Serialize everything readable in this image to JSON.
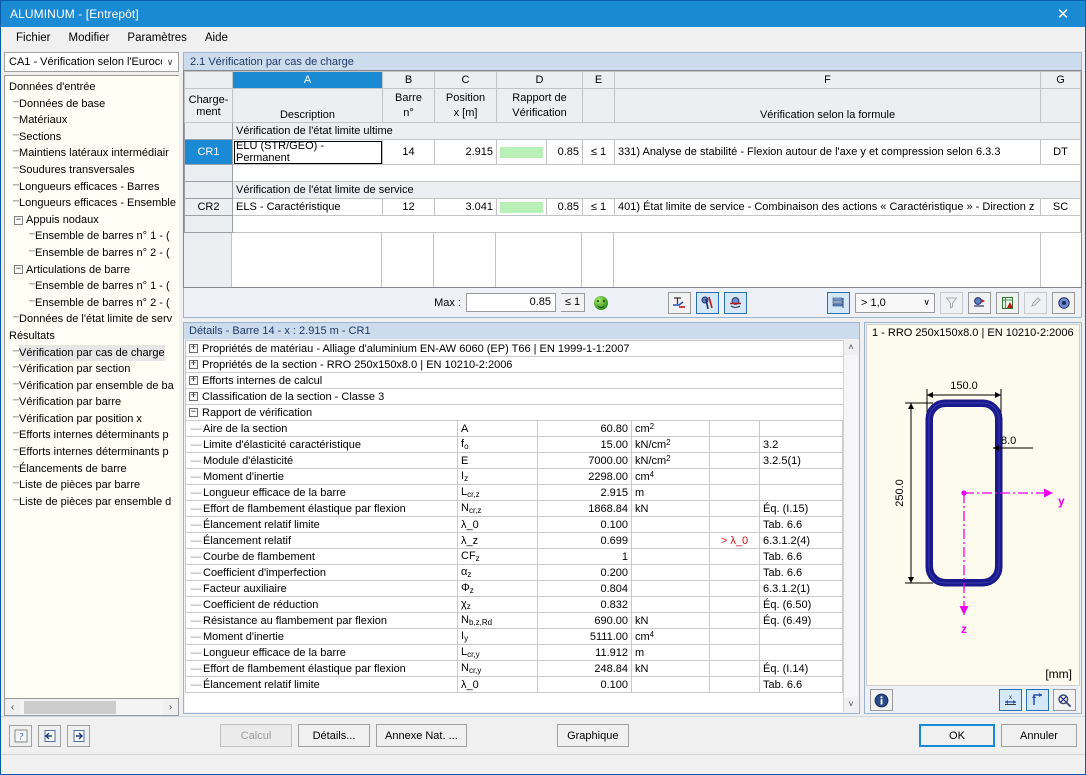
{
  "window": {
    "title": "ALUMINUM - [Entrepôt]",
    "close_icon": "close-icon"
  },
  "menu": {
    "items": [
      "Fichier",
      "Modifier",
      "Paramètres",
      "Aide"
    ]
  },
  "sidebar": {
    "combo_value": "CA1 - Vérification selon l'Euroco",
    "tree": [
      {
        "label": "Données d'entrée",
        "level": 0,
        "expander": "",
        "selected": false
      },
      {
        "label": "Données de base",
        "level": 1,
        "expander": "",
        "selected": false
      },
      {
        "label": "Matériaux",
        "level": 1,
        "expander": "",
        "selected": false
      },
      {
        "label": "Sections",
        "level": 1,
        "expander": "",
        "selected": false
      },
      {
        "label": "Maintiens latéraux intermédiair",
        "level": 1,
        "expander": "",
        "selected": false
      },
      {
        "label": "Soudures transversales",
        "level": 1,
        "expander": "",
        "selected": false
      },
      {
        "label": "Longueurs efficaces - Barres",
        "level": 1,
        "expander": "",
        "selected": false
      },
      {
        "label": "Longueurs efficaces - Ensemble",
        "level": 1,
        "expander": "",
        "selected": false
      },
      {
        "label": "Appuis nodaux",
        "level": 1,
        "expander": "−",
        "selected": false
      },
      {
        "label": "Ensemble de barres n° 1 - (",
        "level": 2,
        "expander": "",
        "selected": false
      },
      {
        "label": "Ensemble de barres n° 2 - (",
        "level": 2,
        "expander": "",
        "selected": false
      },
      {
        "label": "Articulations de barre",
        "level": 1,
        "expander": "−",
        "selected": false
      },
      {
        "label": "Ensemble de barres n° 1 - (",
        "level": 2,
        "expander": "",
        "selected": false
      },
      {
        "label": "Ensemble de barres n° 2 - (",
        "level": 2,
        "expander": "",
        "selected": false
      },
      {
        "label": "Données de l'état limite de serv",
        "level": 1,
        "expander": "",
        "selected": false
      },
      {
        "label": "Résultats",
        "level": 0,
        "expander": "",
        "selected": false
      },
      {
        "label": "Vérification par cas de charge",
        "level": 1,
        "expander": "",
        "selected": true
      },
      {
        "label": "Vérification par section",
        "level": 1,
        "expander": "",
        "selected": false
      },
      {
        "label": "Vérification par ensemble de ba",
        "level": 1,
        "expander": "",
        "selected": false
      },
      {
        "label": "Vérification par barre",
        "level": 1,
        "expander": "",
        "selected": false
      },
      {
        "label": "Vérification par position x",
        "level": 1,
        "expander": "",
        "selected": false
      },
      {
        "label": "Efforts internes déterminants p",
        "level": 1,
        "expander": "",
        "selected": false
      },
      {
        "label": "Efforts internes déterminants p",
        "level": 1,
        "expander": "",
        "selected": false
      },
      {
        "label": "Élancements de barre",
        "level": 1,
        "expander": "",
        "selected": false
      },
      {
        "label": "Liste de pièces par barre",
        "level": 1,
        "expander": "",
        "selected": false
      },
      {
        "label": "Liste de pièces  par ensemble d",
        "level": 1,
        "expander": "",
        "selected": false
      }
    ],
    "scroll_left_icon": "chevron-left-icon",
    "scroll_right_icon": "chevron-right-icon"
  },
  "main": {
    "section_title": "2.1 Vérification par cas de charge",
    "grid": {
      "column_letters": [
        "A",
        "B",
        "C",
        "D",
        "E",
        "F",
        "G"
      ],
      "corner_header": "Charge-\nment",
      "corner_header_line1": "Charge-",
      "corner_header_line2": "ment",
      "sub_headers": {
        "a": "Description",
        "b_line1": "Barre",
        "b_line2": "n°",
        "c_line1": "Position",
        "c_line2": "x [m]",
        "d_line1": "Rapport de",
        "d_line2": "Vérification",
        "e": "",
        "f": "Vérification selon la formule",
        "g": ""
      },
      "group_ultimate": "Vérification de l'état limite ultime",
      "group_service": "Vérification de l'état limite de service",
      "rows": [
        {
          "id": "CR1",
          "description": "ELU (STR/GEO) - Permanent",
          "barre": "14",
          "position": "2.915",
          "ratio": "0.85",
          "limit": "≤ 1",
          "formula": "331) Analyse de stabilité - Flexion autour de l'axe y et compression selon 6.3.3",
          "sc": "DT"
        },
        {
          "id": "CR2",
          "description": "ELS - Caractéristique",
          "barre": "12",
          "position": "3.041",
          "ratio": "0.85",
          "limit": "≤ 1",
          "formula": "401) État limite de service - Combinaison des actions « Caractéristique » - Direction z",
          "sc": "SC"
        }
      ]
    },
    "maxbar": {
      "label": "Max :",
      "value": "0.85",
      "limit": "≤ 1",
      "status_icon": "green-smiley-icon",
      "filter_value": "> 1,0",
      "buttons": [
        {
          "name": "section-view-button",
          "icon": "section-view-icon",
          "active": false
        },
        {
          "name": "member-view-button",
          "icon": "member-view-icon",
          "active": true
        },
        {
          "name": "support-view-button",
          "icon": "support-view-icon",
          "active": true
        },
        {
          "name": "color-bars-button",
          "icon": "color-bars-icon",
          "active": true
        },
        {
          "name": "filter-button",
          "icon": "funnel-icon",
          "active": false
        },
        {
          "name": "render-button",
          "icon": "render-icon",
          "active": false
        },
        {
          "name": "excel-export-button",
          "icon": "excel-icon",
          "active": false
        },
        {
          "name": "pen-button",
          "icon": "pen-icon",
          "active": false
        },
        {
          "name": "view-button",
          "icon": "eye-icon",
          "active": false
        }
      ]
    }
  },
  "details": {
    "header": "Détails - Barre 14 - x : 2.915 m - CR1",
    "groups": [
      {
        "expander": "+",
        "label": "Propriétés de matériau - Alliage d'aluminium EN-AW 6060 (EP) T66 | EN 1999-1-1:2007"
      },
      {
        "expander": "+",
        "label": "Propriétés de la section  -  RRO 250x150x8.0 | EN 10210-2:2006"
      },
      {
        "expander": "+",
        "label": "Efforts internes de calcul"
      },
      {
        "expander": "+",
        "label": "Classification de la section - Classe 3"
      },
      {
        "expander": "−",
        "label": "Rapport de vérification"
      }
    ],
    "columns": [
      "label",
      "symbol",
      "value",
      "unit",
      "note",
      "reference"
    ],
    "rows": [
      {
        "label": "Aire de la section",
        "symbol": "A",
        "sym_sub": "",
        "value": "60.80",
        "unit": "cm",
        "unit_sup": "2",
        "note": "",
        "ref": ""
      },
      {
        "label": "Limite d'élasticité caractéristique",
        "symbol": "f",
        "sym_sub": "o",
        "value": "15.00",
        "unit": "kN/cm",
        "unit_sup": "2",
        "note": "",
        "ref": "3.2"
      },
      {
        "label": "Module d'élasticité",
        "symbol": "E",
        "sym_sub": "",
        "value": "7000.00",
        "unit": "kN/cm",
        "unit_sup": "2",
        "note": "",
        "ref": "3.2.5(1)"
      },
      {
        "label": "Moment d'inertie",
        "symbol": "I",
        "sym_sub": "z",
        "value": "2298.00",
        "unit": "cm",
        "unit_sup": "4",
        "note": "",
        "ref": ""
      },
      {
        "label": "Longueur efficace de la barre",
        "symbol": "L",
        "sym_sub": "cr,z",
        "value": "2.915",
        "unit": "m",
        "unit_sup": "",
        "note": "",
        "ref": ""
      },
      {
        "label": "Effort de flambement élastique par flexion",
        "symbol": "N",
        "sym_sub": "cr,z",
        "value": "1868.84",
        "unit": "kN",
        "unit_sup": "",
        "note": "",
        "ref": "Éq. (I.15)"
      },
      {
        "label": "Élancement relatif limite",
        "symbol": "λ_0",
        "sym_sub": "",
        "value": "0.100",
        "unit": "",
        "unit_sup": "",
        "note": "",
        "ref": "Tab. 6.6"
      },
      {
        "label": "Élancement relatif",
        "symbol": "λ_z",
        "sym_sub": "",
        "value": "0.699",
        "unit": "",
        "unit_sup": "",
        "note": "> λ_0",
        "ref": "6.3.1.2(4)"
      },
      {
        "label": "Courbe de flambement",
        "symbol": "CF",
        "sym_sub": "z",
        "value": "1",
        "unit": "",
        "unit_sup": "",
        "note": "",
        "ref": "Tab. 6.6"
      },
      {
        "label": "Coefficient d'imperfection",
        "symbol": "α",
        "sym_sub": "z",
        "value": "0.200",
        "unit": "",
        "unit_sup": "",
        "note": "",
        "ref": "Tab. 6.6"
      },
      {
        "label": "Facteur auxiliaire",
        "symbol": "Φ",
        "sym_sub": "z",
        "value": "0.804",
        "unit": "",
        "unit_sup": "",
        "note": "",
        "ref": "6.3.1.2(1)"
      },
      {
        "label": "Coefficient de réduction",
        "symbol": "χ",
        "sym_sub": "z",
        "value": "0.832",
        "unit": "",
        "unit_sup": "",
        "note": "",
        "ref": "Éq. (6.50)"
      },
      {
        "label": "Résistance au flambement par flexion",
        "symbol": "N",
        "sym_sub": "b,z,Rd",
        "value": "690.00",
        "unit": "kN",
        "unit_sup": "",
        "note": "",
        "ref": "Éq. (6.49)"
      },
      {
        "label": "Moment d'inertie",
        "symbol": "I",
        "sym_sub": "y",
        "value": "5111.00",
        "unit": "cm",
        "unit_sup": "4",
        "note": "",
        "ref": ""
      },
      {
        "label": "Longueur efficace de la barre",
        "symbol": "L",
        "sym_sub": "cr,y",
        "value": "11.912",
        "unit": "m",
        "unit_sup": "",
        "note": "",
        "ref": ""
      },
      {
        "label": "Effort de flambement élastique par flexion",
        "symbol": "N",
        "sym_sub": "cr,y",
        "value": "248.84",
        "unit": "kN",
        "unit_sup": "",
        "note": "",
        "ref": "Éq. (I.14)"
      },
      {
        "label": "Élancement relatif limite",
        "symbol": "λ_0",
        "sym_sub": "",
        "value": "0.100",
        "unit": "",
        "unit_sup": "",
        "note": "",
        "ref": "Tab. 6.6"
      }
    ],
    "scroll_up_icon": "chevron-up-icon",
    "scroll_down_icon": "chevron-down-icon"
  },
  "section_view": {
    "title": "1 - RRO 250x150x8.0 | EN 10210-2:2006",
    "dim_width": "150.0",
    "dim_height": "250.0",
    "dim_thickness": "8.0",
    "axis_y": "y",
    "axis_z": "z",
    "units": "[mm]",
    "outline_color": "#1a1a8c",
    "axis_color": "#ee00ee",
    "buttons": [
      {
        "name": "info-button",
        "icon": "info-icon",
        "active": false
      },
      {
        "name": "dimensions-button",
        "icon": "dimension-icon",
        "active": true
      },
      {
        "name": "axes-button",
        "icon": "axes-icon",
        "active": true
      },
      {
        "name": "zoom-reset-button",
        "icon": "zoom-reset-icon",
        "active": false
      }
    ]
  },
  "bottom": {
    "help_icon": "help-icon",
    "prev_icon": "prev-view-icon",
    "next_icon": "next-view-icon",
    "calcul": "Calcul",
    "details": "Détails...",
    "annexe": "Annexe Nat. ...",
    "graphique": "Graphique",
    "ok": "OK",
    "cancel": "Annuler"
  }
}
